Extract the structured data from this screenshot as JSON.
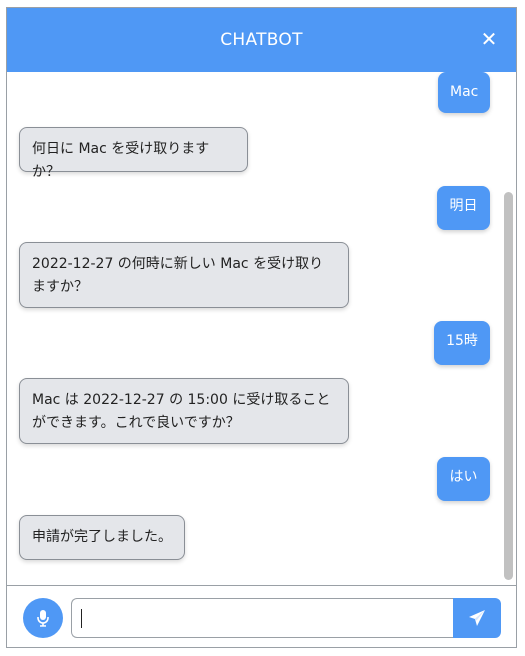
{
  "header": {
    "title": "CHATBOT",
    "close_label": "✕",
    "close_icon": "close-icon"
  },
  "messages": [
    {
      "sender": "user",
      "text": "Mac"
    },
    {
      "sender": "bot",
      "text": "何日に Mac を受け取りますか？"
    },
    {
      "sender": "user",
      "text": "明日"
    },
    {
      "sender": "bot",
      "text": "2022-12-27 の何時に新しい Mac を受け取りますか？"
    },
    {
      "sender": "user",
      "text": "15時"
    },
    {
      "sender": "bot",
      "text": "Mac は 2022-12-27 の 15:00 に受け取ることができます。これで良いですか？"
    },
    {
      "sender": "user",
      "text": "はい"
    },
    {
      "sender": "bot",
      "text": "申請が完了しました。"
    }
  ],
  "input": {
    "value": "",
    "placeholder": "",
    "mic_icon": "microphone-icon",
    "send_icon": "send-icon"
  },
  "colors": {
    "accent": "#4f98f5",
    "bot_bubble": "#e4e6ea"
  }
}
